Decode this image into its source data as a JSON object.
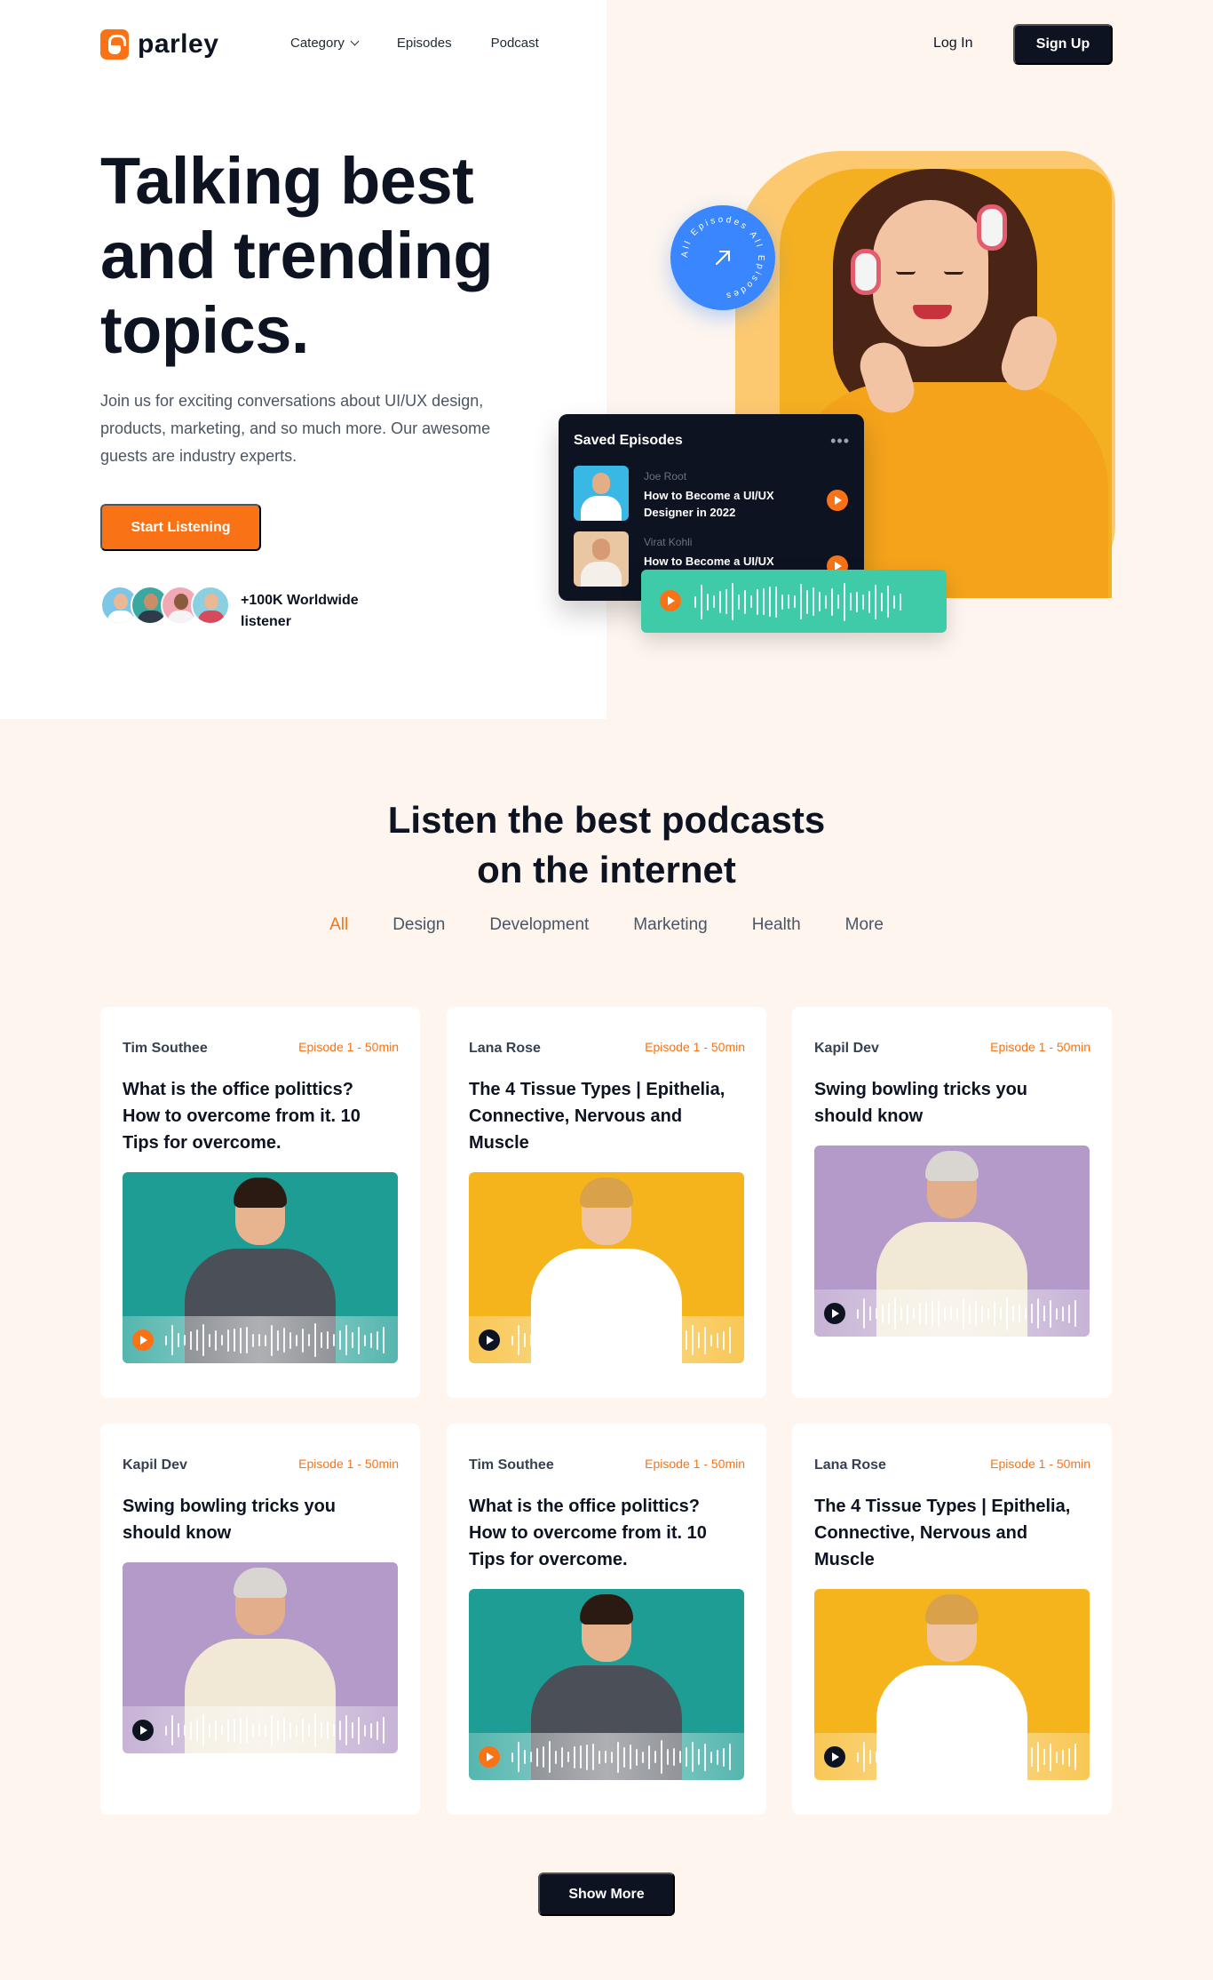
{
  "brand": {
    "name": "parley",
    "accent": "#f97316",
    "dark": "#0d1321"
  },
  "nav": {
    "items": [
      {
        "label": "Category",
        "has_dropdown": true
      },
      {
        "label": "Episodes"
      },
      {
        "label": "Podcast"
      }
    ],
    "login": "Log In",
    "signup": "Sign Up"
  },
  "hero": {
    "title_lines": [
      "Talking best",
      "and trending",
      "topics."
    ],
    "subtitle": "Join us for exciting conversations about UI/UX design, products, marketing, and so much more. Our awesome guests are industry experts.",
    "cta": "Start Listening",
    "listeners": "+100K Worldwide listener",
    "badge_text": "All Episodes All Episodes"
  },
  "saved_episodes": {
    "title": "Saved Episodes",
    "items": [
      {
        "name": "Joe Root",
        "title": "How to Become a UI/UX Designer in 2022"
      },
      {
        "name": "Virat Kohli",
        "title": "How to Become a UI/UX"
      }
    ]
  },
  "section": {
    "title_lines": [
      "Listen the best podcasts",
      "on the internet"
    ],
    "filters": [
      "All",
      "Design",
      "Development",
      "Marketing",
      "Health",
      "More"
    ],
    "active_filter": "All"
  },
  "cards": [
    {
      "name": "Tim Southee",
      "episode": "Episode 1 - 50min",
      "title": "What is the office polittics? How to overcome from it. 10 Tips for overcome.",
      "theme": "teal"
    },
    {
      "name": "Lana Rose",
      "episode": "Episode 1 - 50min",
      "title": "The 4 Tissue Types | Epithelia, Connective, Nervous and Muscle",
      "theme": "yellow"
    },
    {
      "name": "Kapil Dev",
      "episode": "Episode 1 - 50min",
      "title": "Swing bowling tricks you should know",
      "theme": "purple"
    },
    {
      "name": "Kapil Dev",
      "episode": "Episode 1 - 50min",
      "title": "Swing bowling tricks you should know",
      "theme": "purple"
    },
    {
      "name": "Tim Southee",
      "episode": "Episode 1 - 50min",
      "title": "What is the office polittics? How to overcome from it. 10 Tips for overcome.",
      "theme": "teal"
    },
    {
      "name": "Lana Rose",
      "episode": "Episode 1 - 50min",
      "title": "The 4 Tissue Types | Epithelia, Connective, Nervous and Muscle",
      "theme": "yellow"
    }
  ],
  "show_more": "Show More"
}
